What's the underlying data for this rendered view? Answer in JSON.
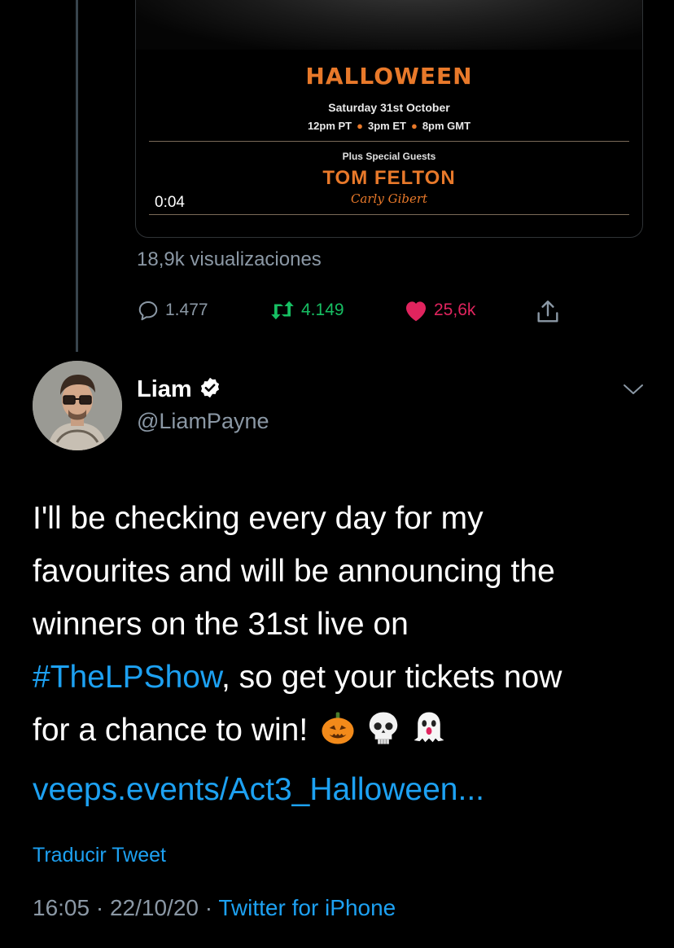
{
  "media": {
    "poster": {
      "title": "HALLOWEEN",
      "date": "Saturday 31st October",
      "times": [
        "12pm PT",
        "3pm ET",
        "8pm GMT"
      ],
      "guests_label": "Plus Special Guests",
      "guest_main": "TOM FELTON",
      "guest_second": "Carly Gibert"
    },
    "timestamp": "0:04",
    "views": "18,9k visualizaciones"
  },
  "previous_actions": {
    "replies": "1.477",
    "retweets": "4.149",
    "likes": "25,6k"
  },
  "tweet": {
    "author_name": "Liam",
    "handle": "@LiamPayne",
    "lines": {
      "l1": "I'll be checking every day for my",
      "l2": "favourites and will be announcing the",
      "l3": "winners on the 31st live on",
      "hashtag": "#TheLPShow",
      "l4_rest": ", so get your tickets now",
      "l5": "for a chance to win!",
      "url": "veeps.events/Act3_Halloween..."
    },
    "translate_label": "Traducir Tweet",
    "time": "16:05",
    "date": "22/10/20",
    "separator": " · ",
    "source": "Twitter for iPhone"
  },
  "colors": {
    "accent_blue": "#1da1f2",
    "retweet_green": "#17bf63",
    "like_red": "#e0245e",
    "muted_gray": "#8b98a5",
    "halloween_orange": "#e8792a"
  },
  "icons": [
    "reply-icon",
    "retweet-icon",
    "heart-icon",
    "share-icon",
    "verified-badge-icon",
    "chevron-down-icon",
    "pumpkin-emoji",
    "skull-emoji",
    "ghost-emoji"
  ]
}
